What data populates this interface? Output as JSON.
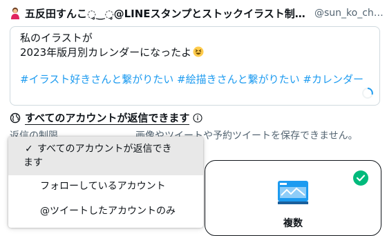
{
  "author": {
    "name": "五反田すんこ◌̥‿◌̥@LINEスタンプとストックイラスト制…",
    "handle": "@sun_ko_ch…"
  },
  "tweet": {
    "line1": "私のイラストが",
    "line2": "2023年版月別カレンダーになったよ",
    "hashtags": "#イラスト好きさんと繋がりたい #絵描きさんと繋がりたい #カレンダー"
  },
  "reply_setting": {
    "label": "すべてのアカウントが返信できます"
  },
  "warning_text": "返信の制限……………………画像やツイートや予約ツイートを保存できません。",
  "dropdown": {
    "items": [
      {
        "check": "✓",
        "label_line1": "すべてのアカウントが返信でき",
        "label_line2": "ます",
        "selected": true
      },
      {
        "label": "フォローしているアカウント",
        "selected": false
      },
      {
        "label": "@ツイートしたアカウントのみ",
        "selected": false
      }
    ]
  },
  "card": {
    "label": "複数",
    "check_color": "#00ba7c"
  },
  "colors": {
    "link": "#1d9bf0",
    "text": "#0f1419",
    "muted": "#536471",
    "border": "#cfd9de"
  }
}
